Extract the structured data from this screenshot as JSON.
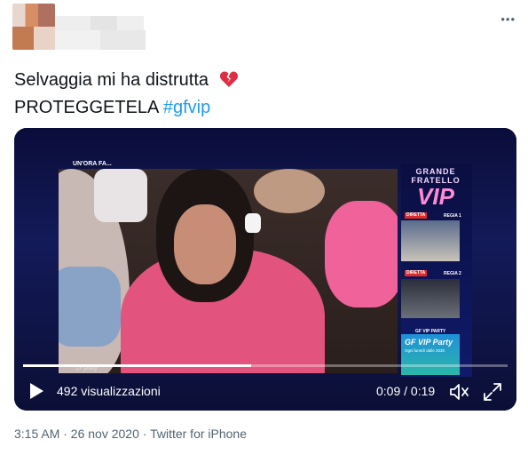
{
  "tweet": {
    "line1": "Selvaggia mi ha distrutta",
    "line2_prefix": "PROTEGGETELA ",
    "hashtag": "#gfvip",
    "emoji_icon": "broken-heart-icon"
  },
  "video": {
    "views": "492 visualizzazioni",
    "time": "0:09 / 0:19",
    "progress": 0.47,
    "overlay": {
      "corner_tag": "UN'ORA FA...",
      "logo_top": "GRANDE FRATELLO",
      "logo_vip": "VIP",
      "diretta": "DIRETTA",
      "regia1": "REGIA 1",
      "regia2": "REGIA 2",
      "gf_party_label": "GF VIP PARTY",
      "party_title": "GF VIP Party",
      "party_sub": "Ogni lunedì dalle 2030",
      "watermark": "play"
    }
  },
  "meta": {
    "line": "3:15 AM · 26 nov 2020 · Twitter for iPhone"
  },
  "colors": {
    "link": "#1d9bf0",
    "meta": "#536471",
    "text": "#0f1419"
  }
}
